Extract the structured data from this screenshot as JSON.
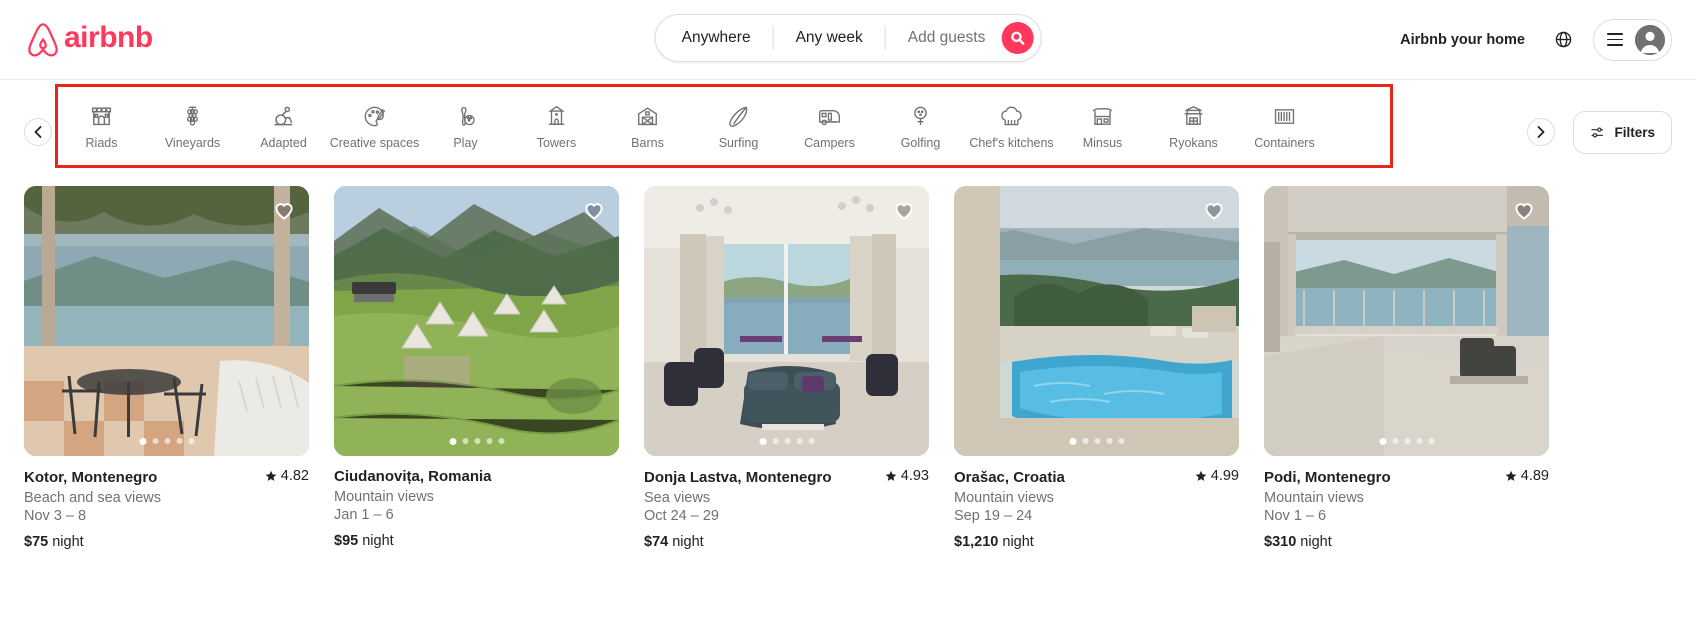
{
  "header": {
    "logo_text": "airbnb",
    "logo_color": "#FF385C",
    "search": {
      "location": "Anywhere",
      "dates": "Any week",
      "guests": "Add guests",
      "search_icon": "search-icon"
    },
    "host_link": "Airbnb your home",
    "globe_icon": "globe-icon",
    "menu_icon": "hamburger-icon",
    "avatar_icon": "user-avatar-icon"
  },
  "categories": {
    "prev_label": "‹",
    "next_label": "›",
    "filters_label": "Filters",
    "filters_icon": "sliders-icon",
    "highlight_color": "#e8271b",
    "items": [
      {
        "label": "Riads",
        "icon": "riad-icon"
      },
      {
        "label": "Vineyards",
        "icon": "grapes-icon"
      },
      {
        "label": "Adapted",
        "icon": "wheelchair-icon"
      },
      {
        "label": "Creative spaces",
        "icon": "palette-icon"
      },
      {
        "label": "Play",
        "icon": "bowling-icon"
      },
      {
        "label": "Towers",
        "icon": "tower-icon"
      },
      {
        "label": "Barns",
        "icon": "barn-icon"
      },
      {
        "label": "Surfing",
        "icon": "surfboard-icon"
      },
      {
        "label": "Campers",
        "icon": "camper-icon"
      },
      {
        "label": "Golfing",
        "icon": "golf-icon"
      },
      {
        "label": "Chef's kitchens",
        "icon": "chef-hat-icon"
      },
      {
        "label": "Minsus",
        "icon": "minsu-house-icon"
      },
      {
        "label": "Ryokans",
        "icon": "ryokan-icon"
      },
      {
        "label": "Containers",
        "icon": "container-icon"
      }
    ]
  },
  "listings": [
    {
      "title": "Kotor, Montenegro",
      "rating": "4.82",
      "subtitle": "Beach and sea views",
      "dates": "Nov 3 – 8",
      "price": "$75",
      "price_unit": "night",
      "photo_alt": "terrace-with-sea-view",
      "dots": 5,
      "active_dot": 0
    },
    {
      "title": "Ciudanovița, Romania",
      "rating": "",
      "subtitle": "Mountain views",
      "dates": "Jan 1 – 6",
      "price": "$95",
      "price_unit": "night",
      "photo_alt": "green-hillside-camp",
      "dots": 5,
      "active_dot": 0
    },
    {
      "title": "Donja Lastva, Montenegro",
      "rating": "4.93",
      "subtitle": "Sea views",
      "dates": "Oct 24 – 29",
      "price": "$74",
      "price_unit": "night",
      "photo_alt": "living-room-with-sea-view",
      "dots": 5,
      "active_dot": 0
    },
    {
      "title": "Orašac, Croatia",
      "rating": "4.99",
      "subtitle": "Mountain views",
      "dates": "Sep 19 – 24",
      "price": "$1,210",
      "price_unit": "night",
      "photo_alt": "pool-overlooking-sea",
      "dots": 5,
      "active_dot": 0
    },
    {
      "title": "Podi, Montenegro",
      "rating": "4.89",
      "subtitle": "Mountain views",
      "dates": "Nov 1 – 6",
      "price": "$310",
      "price_unit": "night",
      "photo_alt": "balcony-with-sea-view",
      "dots": 5,
      "active_dot": 0
    }
  ]
}
